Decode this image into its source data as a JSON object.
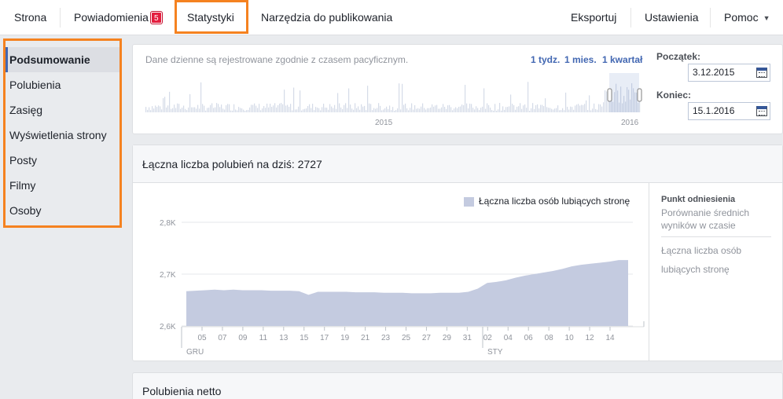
{
  "nav": {
    "tabs": [
      {
        "label": "Strona"
      },
      {
        "label": "Powiadomienia",
        "badge": "5"
      },
      {
        "label": "Statystyki",
        "active": true
      },
      {
        "label": "Narzędzia do publikowania"
      }
    ],
    "right": [
      {
        "label": "Eksportuj"
      },
      {
        "label": "Ustawienia"
      },
      {
        "label": "Pomoc"
      }
    ]
  },
  "sidebar": {
    "items": [
      {
        "label": "Podsumowanie",
        "active": true
      },
      {
        "label": "Polubienia"
      },
      {
        "label": "Zasięg"
      },
      {
        "label": "Wyświetlenia strony"
      },
      {
        "label": "Posty"
      },
      {
        "label": "Filmy"
      },
      {
        "label": "Osoby"
      }
    ]
  },
  "range": {
    "note": "Dane dzienne są rejestrowane zgodnie z czasem pacyficznym.",
    "links": [
      "1 tydz.",
      "1 mies.",
      "1 kwartał"
    ],
    "years": [
      "2015",
      "2016"
    ],
    "start_label": "Początek:",
    "start_value": "3.12.2015",
    "end_label": "Koniec:",
    "end_value": "15.1.2016"
  },
  "likes": {
    "title": "Łączna liczba polubień na dziś: 2727",
    "legend": "Łączna liczba osób lubiących stronę",
    "benchmark_title": "Punkt odniesienia",
    "benchmark_sub": "Porównanie średnich wyników w czasie",
    "benchmark_item": "Łączna liczba osób lubiących stronę"
  },
  "net": {
    "title": "Polubienia netto"
  },
  "chart_data": {
    "type": "area",
    "series": [
      {
        "name": "Łączna liczba osób lubiących stronę",
        "values": [
          2667,
          2668,
          2669,
          2670,
          2669,
          2670,
          2669,
          2669,
          2669,
          2668,
          2668,
          2668,
          2667,
          2660,
          2666,
          2666,
          2666,
          2666,
          2665,
          2665,
          2665,
          2664,
          2664,
          2664,
          2663,
          2663,
          2663,
          2664,
          2664,
          2664,
          2666,
          2672,
          2683,
          2685,
          2688,
          2693,
          2697,
          2700,
          2703,
          2706,
          2710,
          2715,
          2718,
          2720,
          2722,
          2724,
          2727,
          2727
        ]
      }
    ],
    "x_tick_labels": [
      "05",
      "07",
      "09",
      "11",
      "13",
      "15",
      "17",
      "19",
      "21",
      "23",
      "25",
      "27",
      "29",
      "31",
      "02",
      "04",
      "06",
      "08",
      "10",
      "12",
      "14"
    ],
    "month_labels": [
      "GRU",
      "STY"
    ],
    "y_tick_labels": [
      "2,8K",
      "2,7K",
      "2,6K"
    ],
    "ylim": [
      2600,
      2800
    ],
    "grid": true,
    "colors": {
      "fill": "#c4cbe0"
    }
  }
}
